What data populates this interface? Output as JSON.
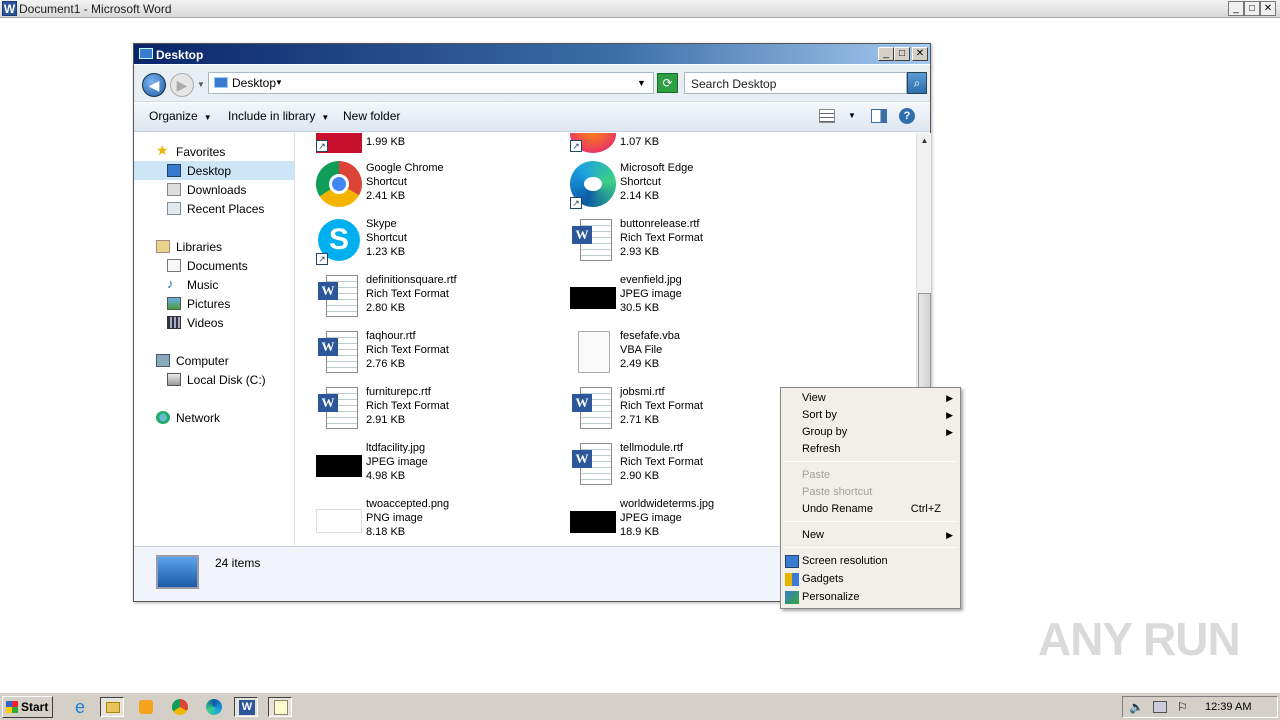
{
  "word": {
    "title": "Document1 - Microsoft Word",
    "icon": "W",
    "min": "_",
    "max": "□",
    "close": "✕"
  },
  "explorer": {
    "title": "Desktop",
    "address": "Desktop",
    "search_placeholder": "Search Desktop",
    "toolbar": {
      "organize": "Organize",
      "include": "Include in library",
      "new_folder": "New folder"
    },
    "nav": {
      "favorites": "Favorites",
      "desktop": "Desktop",
      "downloads": "Downloads",
      "recent": "Recent Places",
      "libraries": "Libraries",
      "documents": "Documents",
      "music": "Music",
      "pictures": "Pictures",
      "videos": "Videos",
      "computer": "Computer",
      "local_disk": "Local Disk (C:)",
      "network": "Network"
    },
    "files": [
      {
        "name": "",
        "type": "",
        "size": "1.99 KB",
        "icon": "filezilla-icon"
      },
      {
        "name": "",
        "type": "",
        "size": "1.07 KB",
        "icon": "firefox-icon"
      },
      {
        "name": "Google Chrome",
        "type": "Shortcut",
        "size": "2.41 KB",
        "icon": "chrome-icon"
      },
      {
        "name": "Microsoft Edge",
        "type": "Shortcut",
        "size": "2.14 KB",
        "icon": "edge-icon"
      },
      {
        "name": "Skype",
        "type": "Shortcut",
        "size": "1.23 KB",
        "icon": "skype-icon"
      },
      {
        "name": "buttonrelease.rtf",
        "type": "Rich Text Format",
        "size": "2.93 KB",
        "icon": "word-doc-icon"
      },
      {
        "name": "definitionsquare.rtf",
        "type": "Rich Text Format",
        "size": "2.80 KB",
        "icon": "word-doc-icon"
      },
      {
        "name": "evenfield.jpg",
        "type": "JPEG image",
        "size": "30.5 KB",
        "icon": "image-thumbnail-icon"
      },
      {
        "name": "faqhour.rtf",
        "type": "Rich Text Format",
        "size": "2.76 KB",
        "icon": "word-doc-icon"
      },
      {
        "name": "fesefafe.vba",
        "type": "VBA File",
        "size": "2.49 KB",
        "icon": "blank-file-icon"
      },
      {
        "name": "furniturepc.rtf",
        "type": "Rich Text Format",
        "size": "2.91 KB",
        "icon": "word-doc-icon"
      },
      {
        "name": "jobsmi.rtf",
        "type": "Rich Text Format",
        "size": "2.71 KB",
        "icon": "word-doc-icon"
      },
      {
        "name": "ltdfacility.jpg",
        "type": "JPEG image",
        "size": "4.98 KB",
        "icon": "image-thumbnail-icon"
      },
      {
        "name": "tellmodule.rtf",
        "type": "Rich Text Format",
        "size": "2.90 KB",
        "icon": "word-doc-icon"
      },
      {
        "name": "twoaccepted.png",
        "type": "PNG image",
        "size": "8.18 KB",
        "icon": "png-thumbnail-icon"
      },
      {
        "name": "worldwideterms.jpg",
        "type": "JPEG image",
        "size": "18.9 KB",
        "icon": "image-thumbnail-icon"
      }
    ],
    "details": "24 items"
  },
  "context_menu": {
    "view": "View",
    "sort_by": "Sort by",
    "group_by": "Group by",
    "refresh": "Refresh",
    "paste": "Paste",
    "paste_shortcut": "Paste shortcut",
    "undo_rename": "Undo Rename",
    "undo_shortcut": "Ctrl+Z",
    "new": "New",
    "screen_resolution": "Screen resolution",
    "gadgets": "Gadgets",
    "personalize": "Personalize"
  },
  "taskbar": {
    "start": "Start",
    "clock": "12:39 AM"
  },
  "watermark": "ANY RUN"
}
